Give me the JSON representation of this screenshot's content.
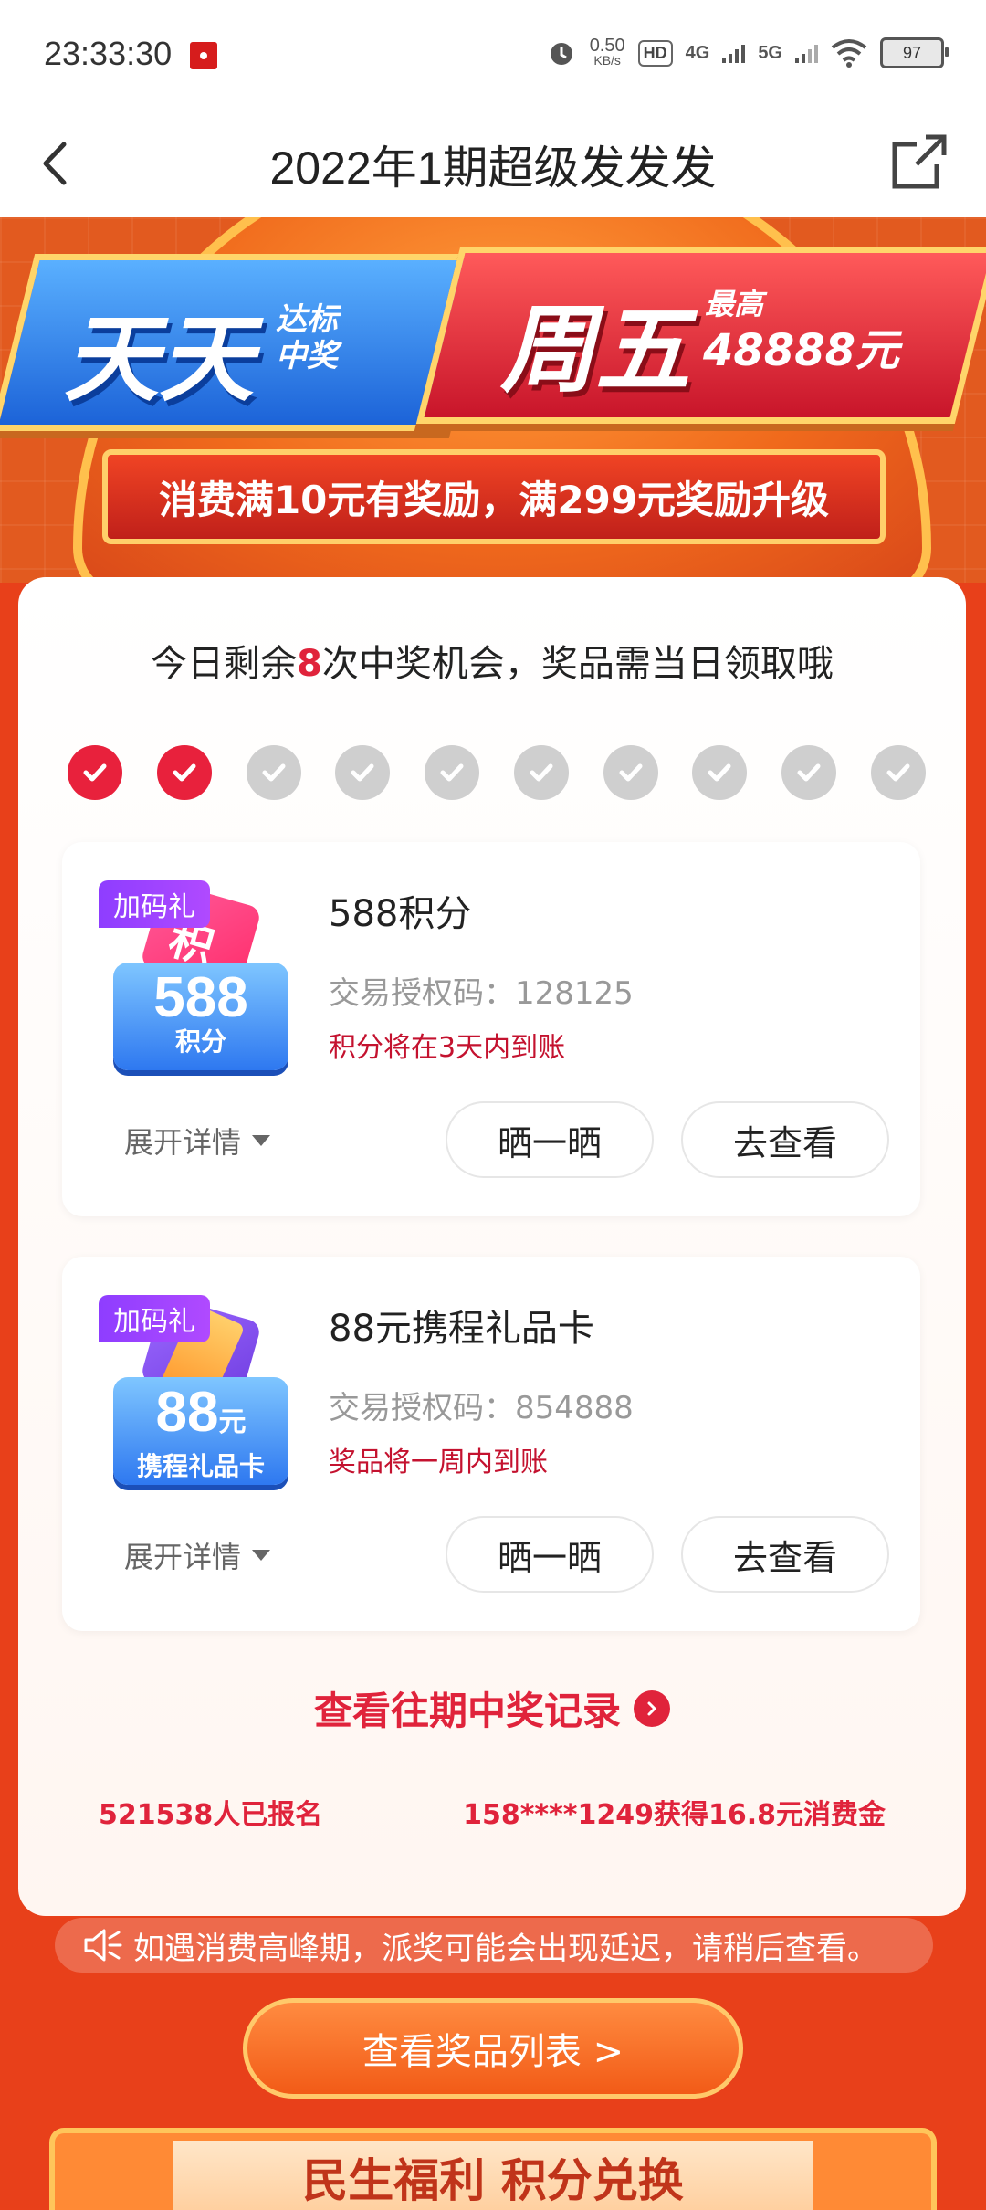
{
  "status_bar": {
    "time": "23:33:30",
    "net_speed_value": "0.50",
    "net_speed_unit": "KB/s",
    "hd_label": "HD",
    "network_4g": "4G",
    "network_5g": "5G",
    "battery": "97"
  },
  "nav": {
    "title": "2022年1期超级发发发"
  },
  "banner": {
    "left_big": "天天",
    "left_small_1": "达标",
    "left_small_2": "中奖",
    "right_big": "周五",
    "right_small": "最高",
    "right_amount": "48888元",
    "ribbon": "消费满10元有奖励，满299元奖励升级"
  },
  "panel": {
    "remaining_prefix": "今日剩余",
    "remaining_count": "8",
    "remaining_suffix": "次中奖机会，奖品需当日领取哦",
    "checks_total": 10,
    "checks_done": 2,
    "cards": [
      {
        "badge": "加码礼",
        "icon_back_text": "积",
        "icon_big": "588",
        "icon_big_unit": "",
        "icon_sub": "积分",
        "name": "588积分",
        "auth_code": "交易授权码：128125",
        "arrival": "积分将在3天内到账",
        "expand": "展开详情",
        "share": "晒一晒",
        "view": "去查看"
      },
      {
        "badge": "加码礼",
        "icon_back_text": "",
        "icon_big": "88",
        "icon_big_unit": "元",
        "icon_sub": "携程礼品卡",
        "name": "88元携程礼品卡",
        "auth_code": "交易授权码：854888",
        "arrival": "奖品将一周内到账",
        "expand": "展开详情",
        "share": "晒一晒",
        "view": "去查看"
      }
    ],
    "history_link": "查看往期中奖记录",
    "signup_count": "521538人已报名",
    "winner_ticker": "158****1249获得16.8元消费金"
  },
  "notice": "如遇消费高峰期，派奖可能会出现延迟，请稍后查看。",
  "cta": "查看奖品列表 >",
  "bottom_banner": "民生福利 积分兑换",
  "colors": {
    "accent_red": "#e0233b",
    "page_orange": "#e8401a",
    "check_on": "#e8213c",
    "check_off": "#cfcfcf"
  }
}
